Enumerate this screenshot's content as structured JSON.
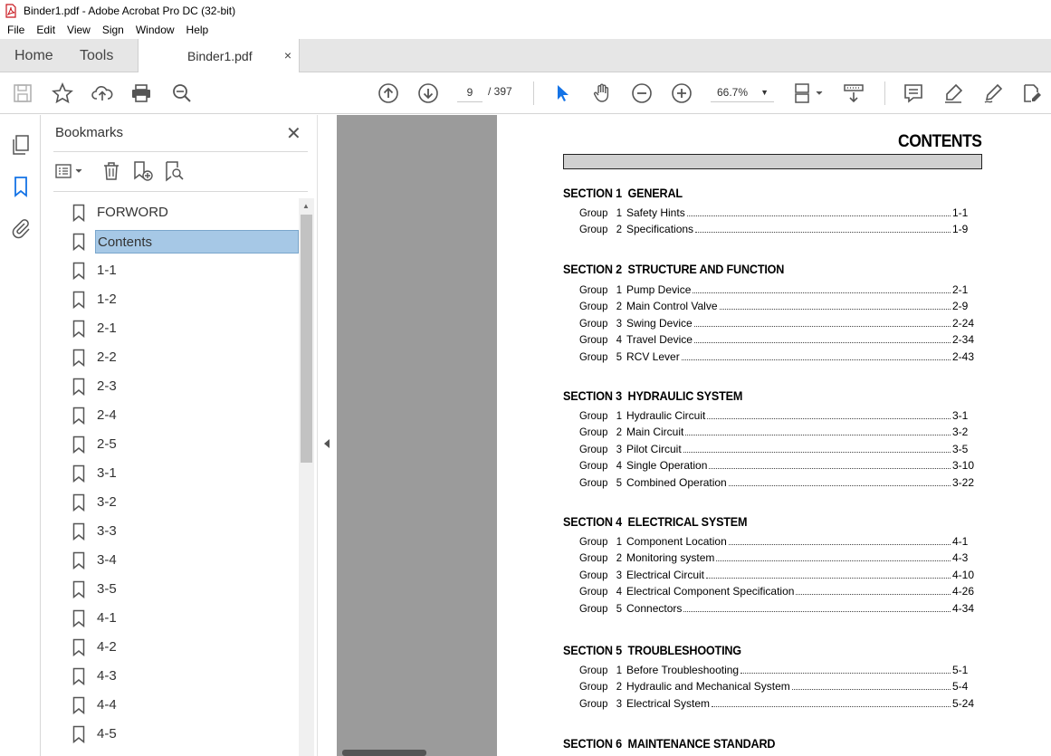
{
  "window": {
    "title": "Binder1.pdf - Adobe Acrobat Pro DC (32-bit)"
  },
  "menu": [
    "File",
    "Edit",
    "View",
    "Sign",
    "Window",
    "Help"
  ],
  "tabs": {
    "home": "Home",
    "tools": "Tools",
    "document": "Binder1.pdf",
    "close": "×"
  },
  "toolbar": {
    "current_page": "9",
    "total_pages": "/ 397",
    "zoom": "66.7%"
  },
  "bookmarks": {
    "title": "Bookmarks",
    "close": "✕",
    "items": [
      {
        "label": "FORWORD",
        "selected": false
      },
      {
        "label": "Contents",
        "selected": true
      },
      {
        "label": "1-1",
        "selected": false
      },
      {
        "label": "1-2",
        "selected": false
      },
      {
        "label": "2-1",
        "selected": false
      },
      {
        "label": "2-2",
        "selected": false
      },
      {
        "label": "2-3",
        "selected": false
      },
      {
        "label": "2-4",
        "selected": false
      },
      {
        "label": "2-5",
        "selected": false
      },
      {
        "label": "3-1",
        "selected": false
      },
      {
        "label": "3-2",
        "selected": false
      },
      {
        "label": "3-3",
        "selected": false
      },
      {
        "label": "3-4",
        "selected": false
      },
      {
        "label": "3-5",
        "selected": false
      },
      {
        "label": "4-1",
        "selected": false
      },
      {
        "label": "4-2",
        "selected": false
      },
      {
        "label": "4-3",
        "selected": false
      },
      {
        "label": "4-4",
        "selected": false
      },
      {
        "label": "4-5",
        "selected": false
      }
    ]
  },
  "document": {
    "title": "CONTENTS",
    "sections": [
      {
        "heading": "SECTION 1  GENERAL",
        "entries": [
          {
            "group": "Group   1",
            "title": "Safety Hints",
            "page": "1-1"
          },
          {
            "group": "Group   2",
            "title": "Specifications",
            "page": "1-9"
          }
        ]
      },
      {
        "heading": "SECTION 2  STRUCTURE AND FUNCTION",
        "entries": [
          {
            "group": "Group   1",
            "title": "Pump Device",
            "page": "2-1"
          },
          {
            "group": "Group   2",
            "title": "Main Control Valve",
            "page": "2-9"
          },
          {
            "group": "Group   3",
            "title": "Swing Device",
            "page": "2-24"
          },
          {
            "group": "Group   4",
            "title": "Travel Device",
            "page": "2-34"
          },
          {
            "group": "Group   5",
            "title": "RCV Lever",
            "page": "2-43"
          }
        ]
      },
      {
        "heading": "SECTION 3  HYDRAULIC SYSTEM",
        "entries": [
          {
            "group": "Group   1",
            "title": "Hydraulic Circuit",
            "page": "3-1"
          },
          {
            "group": "Group   2",
            "title": "Main Circuit",
            "page": "3-2"
          },
          {
            "group": "Group   3",
            "title": "Pilot Circuit",
            "page": "3-5"
          },
          {
            "group": "Group   4",
            "title": "Single Operation",
            "page": "3-10"
          },
          {
            "group": "Group   5",
            "title": "Combined Operation",
            "page": "3-22"
          }
        ]
      },
      {
        "heading": "SECTION 4  ELECTRICAL SYSTEM",
        "entries": [
          {
            "group": "Group   1",
            "title": "Component Location",
            "page": "4-1"
          },
          {
            "group": "Group   2",
            "title": "Monitoring system",
            "page": "4-3"
          },
          {
            "group": "Group   3",
            "title": "Electrical Circuit",
            "page": "4-10"
          },
          {
            "group": "Group   4",
            "title": "Electrical Component Specification",
            "page": "4-26"
          },
          {
            "group": "Group   5",
            "title": "Connectors",
            "page": "4-34"
          }
        ]
      },
      {
        "heading": "SECTION 5  TROUBLESHOOTING",
        "entries": [
          {
            "group": "Group   1",
            "title": "Before Troubleshooting",
            "page": "5-1"
          },
          {
            "group": "Group   2",
            "title": "Hydraulic and Mechanical System",
            "page": "5-4"
          },
          {
            "group": "Group   3",
            "title": "Electrical System",
            "page": "5-24"
          }
        ]
      },
      {
        "heading": "SECTION 6  MAINTENANCE STANDARD",
        "entries": []
      }
    ]
  }
}
